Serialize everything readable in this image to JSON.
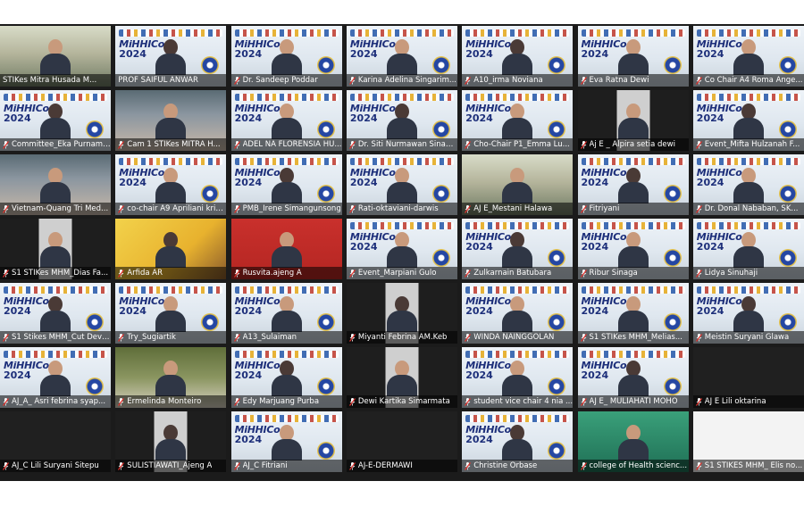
{
  "banner": {
    "title": "MiHHICo",
    "year": "2024"
  },
  "participants": [
    {
      "name": "STIKes Mitra Husada M...",
      "bg": "room",
      "active": false,
      "muted": false
    },
    {
      "name": "PROF SAIFUL ANWAR",
      "bg": "banner",
      "active": true,
      "muted": false
    },
    {
      "name": "Dr. Sandeep Poddar",
      "bg": "banner",
      "active": false,
      "muted": true
    },
    {
      "name": "Karina Adelina Singarim...",
      "bg": "banner",
      "active": false,
      "muted": true
    },
    {
      "name": "A10_irma Noviana",
      "bg": "banner",
      "active": false,
      "muted": true
    },
    {
      "name": "Eva Ratna Dewi",
      "bg": "banner",
      "active": false,
      "muted": true
    },
    {
      "name": "Co Chair A4 Roma Ange...",
      "bg": "banner",
      "active": false,
      "muted": true
    },
    {
      "name": "Committee_Eka Purnami...",
      "bg": "banner",
      "active": false,
      "muted": true
    },
    {
      "name": "Cam 1 STIKes MITRA H...",
      "bg": "hall",
      "active": false,
      "muted": true
    },
    {
      "name": "ADEL NA FLORENSIA HU...",
      "bg": "banner",
      "active": false,
      "muted": true
    },
    {
      "name": "Dr. Siti Nurmawan Sinag...",
      "bg": "banner",
      "active": false,
      "muted": true
    },
    {
      "name": "Cho-Chair P1_Emma Lu...",
      "bg": "banner",
      "active": false,
      "muted": true
    },
    {
      "name": "Aj E _ Alpira setia dewi",
      "bg": "doorway",
      "active": false,
      "muted": true
    },
    {
      "name": "Event_Mifta Hulzanah F...",
      "bg": "banner",
      "active": false,
      "muted": true
    },
    {
      "name": "Vietnam-Quang Tri Med...",
      "bg": "hall",
      "active": false,
      "muted": true
    },
    {
      "name": "co-chair A9 Apriliani kris...",
      "bg": "banner",
      "active": false,
      "muted": true
    },
    {
      "name": "PMB_Irene Simangunsong",
      "bg": "banner",
      "active": false,
      "muted": true
    },
    {
      "name": "Rati-oktaviani-darwis",
      "bg": "banner",
      "active": false,
      "muted": true
    },
    {
      "name": "AJ E_Mestani Halawa",
      "bg": "room",
      "active": false,
      "muted": true
    },
    {
      "name": "Fitriyani",
      "bg": "banner",
      "active": false,
      "muted": true
    },
    {
      "name": "Dr. Donal Nababan, SK...",
      "bg": "banner",
      "active": false,
      "muted": true
    },
    {
      "name": "S1 STIKes MHM_Dias Fa...",
      "bg": "doorway",
      "active": false,
      "muted": true
    },
    {
      "name": "Arfida AR",
      "bg": "poster",
      "active": false,
      "muted": true
    },
    {
      "name": "Rusvita.ajeng A",
      "bg": "red",
      "active": false,
      "muted": true
    },
    {
      "name": "Event_Marpiani Gulo",
      "bg": "banner",
      "active": false,
      "muted": true
    },
    {
      "name": "Zulkarnain Batubara",
      "bg": "banner",
      "active": false,
      "muted": true
    },
    {
      "name": "Ribur Sinaga",
      "bg": "banner",
      "active": false,
      "muted": true
    },
    {
      "name": "Lidya Sinuhaji",
      "bg": "banner",
      "active": false,
      "muted": true
    },
    {
      "name": "S1 Stikes MHM_Cut Devi...",
      "bg": "banner",
      "active": false,
      "muted": true
    },
    {
      "name": "Try_Sugiartik",
      "bg": "banner",
      "active": false,
      "muted": true
    },
    {
      "name": "A13_Sulaiman",
      "bg": "banner",
      "active": false,
      "muted": true
    },
    {
      "name": "Miyanti Febrina AM.Keb",
      "bg": "doorway",
      "active": false,
      "muted": true
    },
    {
      "name": "WINDA NAINGGOLAN",
      "bg": "banner",
      "active": false,
      "muted": true
    },
    {
      "name": "S1 STIKes MHM_Melias...",
      "bg": "banner",
      "active": false,
      "muted": true
    },
    {
      "name": "Meistin Suryani Glawa",
      "bg": "banner",
      "active": false,
      "muted": true
    },
    {
      "name": "AJ_A_ Asri febrina syap...",
      "bg": "banner",
      "active": false,
      "muted": true
    },
    {
      "name": "Ermelinda Monteiro",
      "bg": "shelf",
      "active": false,
      "muted": true
    },
    {
      "name": "Edy Marjuang Purba",
      "bg": "banner",
      "active": false,
      "muted": true
    },
    {
      "name": "Dewi Kartika Simarmata",
      "bg": "doorway",
      "active": false,
      "muted": true
    },
    {
      "name": "student vice chair 4 nia ...",
      "bg": "banner",
      "active": false,
      "muted": true
    },
    {
      "name": "AJ E_ MULIAHATI MOHO",
      "bg": "banner",
      "active": false,
      "muted": true
    },
    {
      "name": "AJ E Lili oktarina",
      "bg": "dark",
      "active": false,
      "muted": true
    },
    {
      "name": "AJ_C Lili Suryani Sitepu",
      "bg": "dark",
      "active": false,
      "muted": true
    },
    {
      "name": "SULISTIAWATI_Ajeng A",
      "bg": "doorway",
      "active": false,
      "muted": true
    },
    {
      "name": "AJ_C Fitriani",
      "bg": "banner",
      "active": false,
      "muted": true
    },
    {
      "name": "AJ-E-DERMAWI",
      "bg": "dark",
      "active": false,
      "muted": true
    },
    {
      "name": "Christine Orbase",
      "bg": "banner",
      "active": false,
      "muted": true
    },
    {
      "name": "college of Health scienc...",
      "bg": "green",
      "active": false,
      "muted": true
    },
    {
      "name": "S1 STIKES MHM_ Elis no...",
      "bg": "white",
      "active": false,
      "muted": true
    }
  ]
}
